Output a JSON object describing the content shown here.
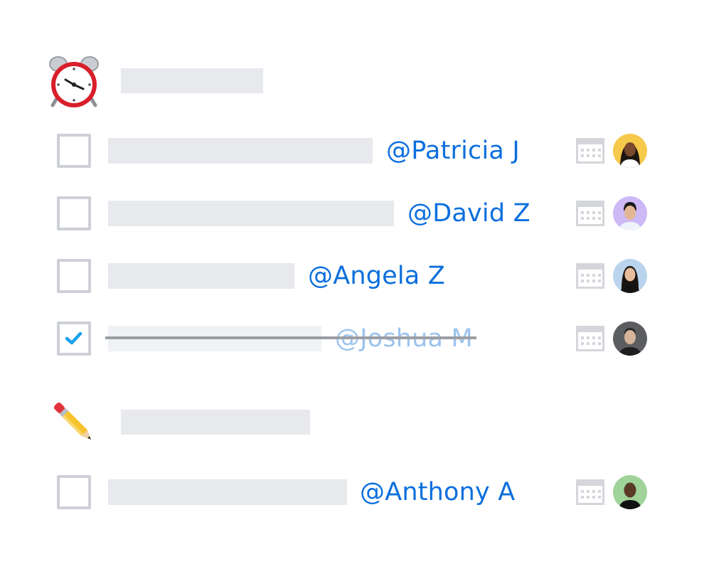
{
  "sections": [
    {
      "icon": "alarm-clock-icon",
      "tasks": [
        {
          "assignee": "@Patricia J",
          "done": false,
          "avatar_bg": "#f6c94a"
        },
        {
          "assignee": "@David Z",
          "done": false,
          "avatar_bg": "#cdb9f5"
        },
        {
          "assignee": "@Angela Z",
          "done": false,
          "avatar_bg": "#b9d4ec"
        },
        {
          "assignee": "@Joshua M",
          "done": true,
          "avatar_bg": "#5b5d60"
        }
      ]
    },
    {
      "icon": "pencil-icon",
      "tasks": [
        {
          "assignee": "@Anthony A",
          "done": false,
          "avatar_bg": "#9fd39a"
        }
      ]
    }
  ],
  "colors": {
    "mention": "#0c6fdd",
    "mention_done": "#9cc4ee",
    "placeholder": "#e8e9ed",
    "checkbox_border": "#cdd0d6",
    "check_mark": "#1aa0ea"
  }
}
